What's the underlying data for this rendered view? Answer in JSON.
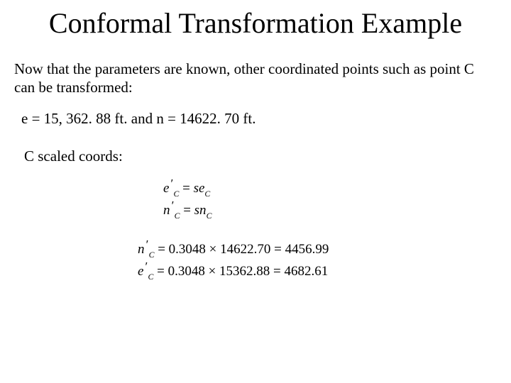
{
  "title": "Conformal Transformation Example",
  "intro": "Now that the parameters are known, other coordinated points such as point C can be transformed:",
  "values_line": "e =  15, 362. 88 ft. and n  = 14622. 70 ft.",
  "scaled_label": "C scaled coords:",
  "eq1_lhs_var": "e",
  "eq1_lhs_sub": "C",
  "eq1_rhs1": "se",
  "eq1_rhs1_sub": "C",
  "eq2_lhs_var": "n",
  "eq2_lhs_sub": "C",
  "eq2_rhs1": "sn",
  "eq2_rhs1_sub": "C",
  "eq3_lhs_var": "n",
  "eq3_lhs_sub": "C",
  "eq3_rhs": " = 0.3048 × 14622.70 = 4456.99",
  "eq4_lhs_var": "e",
  "eq4_lhs_sub": "C",
  "eq4_rhs": " = 0.3048 × 15362.88 = 4682.61",
  "eq_sign": " = "
}
